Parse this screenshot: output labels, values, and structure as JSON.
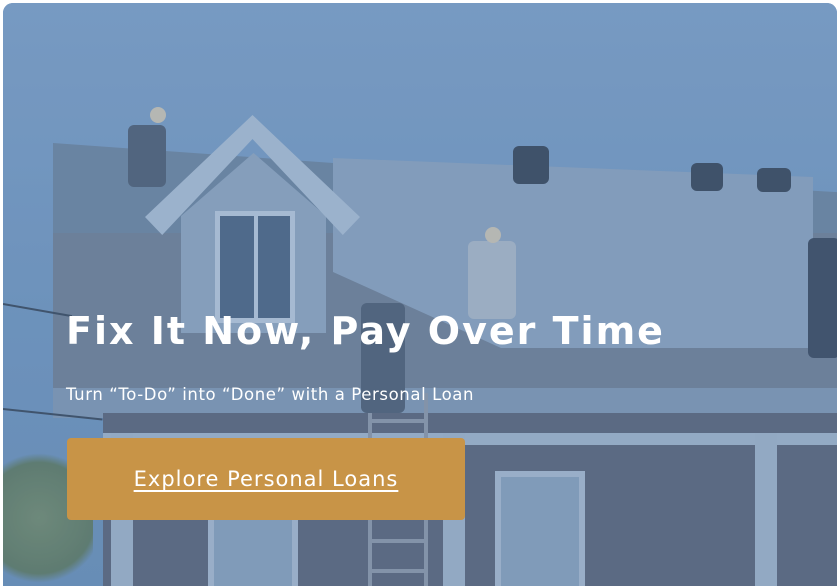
{
  "hero": {
    "title": "Fix It Now, Pay Over Time",
    "subtitle": "Turn “To-Do” into “Done” with a Personal Loan",
    "cta_label": "Explore Personal Loans",
    "background_image": "house-roof-repair-photo"
  },
  "colors": {
    "cta_background": "#c89447",
    "overlay_tint": "#6e93bb",
    "text": "#ffffff"
  }
}
